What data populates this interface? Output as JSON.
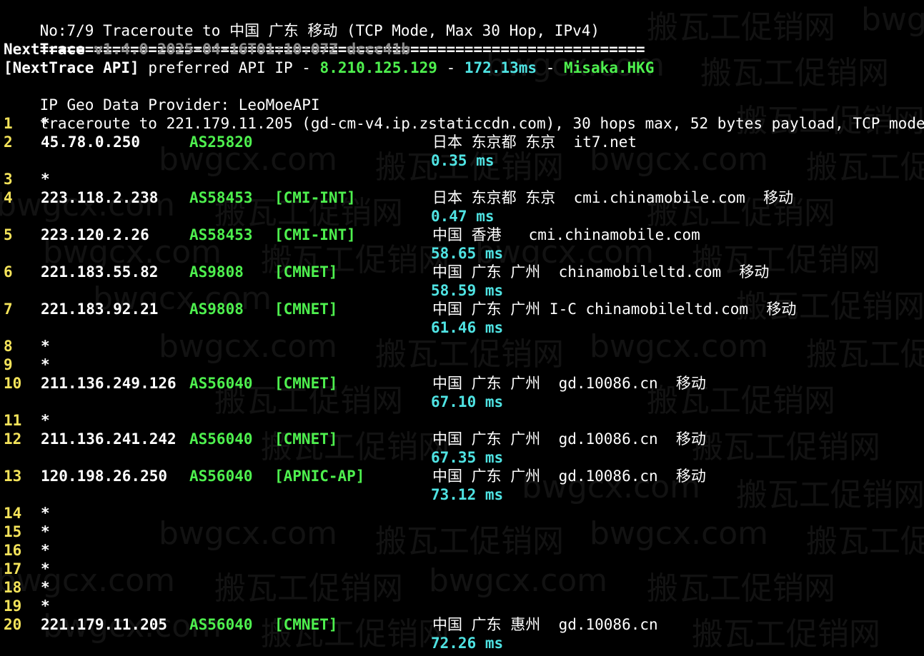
{
  "header": {
    "title": "No:7/9 Traceroute to 中国 广东 移动 (TCP Mode, Max 30 Hop, IPv4)",
    "rule": "==================================================================="
  },
  "banner": {
    "name": "NextTrace",
    "version": "v1.4.0 2025-04-16T01:10:07Z dccc41b"
  },
  "api": {
    "prefix": "[NextTrace API]",
    "text": "preferred API IP -",
    "ip": "8.210.125.129",
    "sep1": "-",
    "latency": "172.13ms",
    "sep2": "-",
    "node": "Misaka.HKG"
  },
  "provider": "IP Geo Data Provider: LeoMoeAPI",
  "traceroute_line": "traceroute to 221.179.11.205 (gd-cm-v4.ip.zstaticcdn.com), 30 hops max, 52 bytes payload, TCP mode",
  "hops": [
    {
      "hop": "1",
      "star": "*"
    },
    {
      "hop": "2",
      "ip": "45.78.0.250",
      "as": "AS25820",
      "tag": "",
      "geo": "日本 东京都 东京  it7.net",
      "rtt": "0.35 ms"
    },
    {
      "hop": "3",
      "star": "*"
    },
    {
      "hop": "4",
      "ip": "223.118.2.238",
      "as": "AS58453",
      "tag": "[CMI-INT]",
      "geo": "日本 东京都 东京  cmi.chinamobile.com  移动",
      "rtt": "0.47 ms"
    },
    {
      "hop": "5",
      "ip": "223.120.2.26",
      "as": "AS58453",
      "tag": "[CMI-INT]",
      "geo": "中国 香港   cmi.chinamobile.com",
      "rtt": "58.65 ms"
    },
    {
      "hop": "6",
      "ip": "221.183.55.82",
      "as": "AS9808",
      "tag": "[CMNET]",
      "geo": "中国 广东 广州  chinamobileltd.com  移动",
      "rtt": "58.59 ms"
    },
    {
      "hop": "7",
      "ip": "221.183.92.21",
      "as": "AS9808",
      "tag": "[CMNET]",
      "geo": "中国 广东 广州 I-C chinamobileltd.com  移动",
      "rtt": "61.46 ms"
    },
    {
      "hop": "8",
      "star": "*"
    },
    {
      "hop": "9",
      "star": "*"
    },
    {
      "hop": "10",
      "ip": "211.136.249.126",
      "as": "AS56040",
      "tag": "[CMNET]",
      "geo": "中国 广东 广州  gd.10086.cn  移动",
      "rtt": "67.10 ms"
    },
    {
      "hop": "11",
      "star": "*"
    },
    {
      "hop": "12",
      "ip": "211.136.241.242",
      "as": "AS56040",
      "tag": "[CMNET]",
      "geo": "中国 广东 广州  gd.10086.cn  移动",
      "rtt": "67.35 ms"
    },
    {
      "hop": "13",
      "ip": "120.198.26.250",
      "as": "AS56040",
      "tag": "[APNIC-AP]",
      "geo": "中国 广东 广州  gd.10086.cn  移动",
      "rtt": "73.12 ms"
    },
    {
      "hop": "14",
      "star": "*"
    },
    {
      "hop": "15",
      "star": "*"
    },
    {
      "hop": "16",
      "star": "*"
    },
    {
      "hop": "17",
      "star": "*"
    },
    {
      "hop": "18",
      "star": "*"
    },
    {
      "hop": "19",
      "star": "*"
    },
    {
      "hop": "20",
      "ip": "221.179.11.205",
      "as": "AS56040",
      "tag": "[CMNET]",
      "geo": "中国 广东 惠州  gd.10086.cn",
      "rtt": "72.26 ms"
    }
  ],
  "watermark": {
    "site": "bwgcx.com",
    "brand": "搬瓦工促销网"
  }
}
